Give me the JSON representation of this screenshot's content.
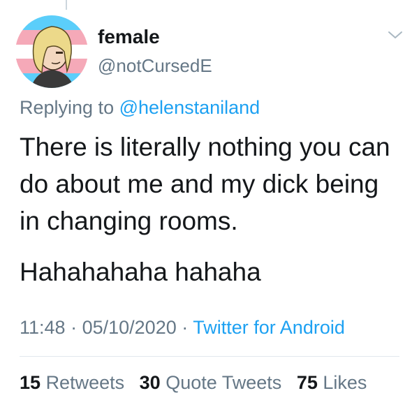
{
  "tweet": {
    "display_name": "female",
    "handle": "@notCursedE",
    "avatar": "avatar-illustration",
    "menu_icon": "chevron-down-icon",
    "replying_prefix": "Replying to",
    "replying_to": "@helenstaniland",
    "text_lines": [
      "There is literally nothing you can do about me and my dick being in changing rooms.",
      "Hahahahaha hahaha"
    ],
    "time": "11:48",
    "separator": "·",
    "date": "05/10/2020",
    "source": "Twitter for Android",
    "stats": {
      "retweets_count": "15",
      "retweets_label": "Retweets",
      "quote_count": "30",
      "quote_label": "Quote Tweets",
      "likes_count": "75",
      "likes_label": "Likes"
    }
  },
  "colors": {
    "text": "#14171a",
    "secondary": "#657786",
    "link": "#1da1f2",
    "divider": "#e1e8ed"
  }
}
